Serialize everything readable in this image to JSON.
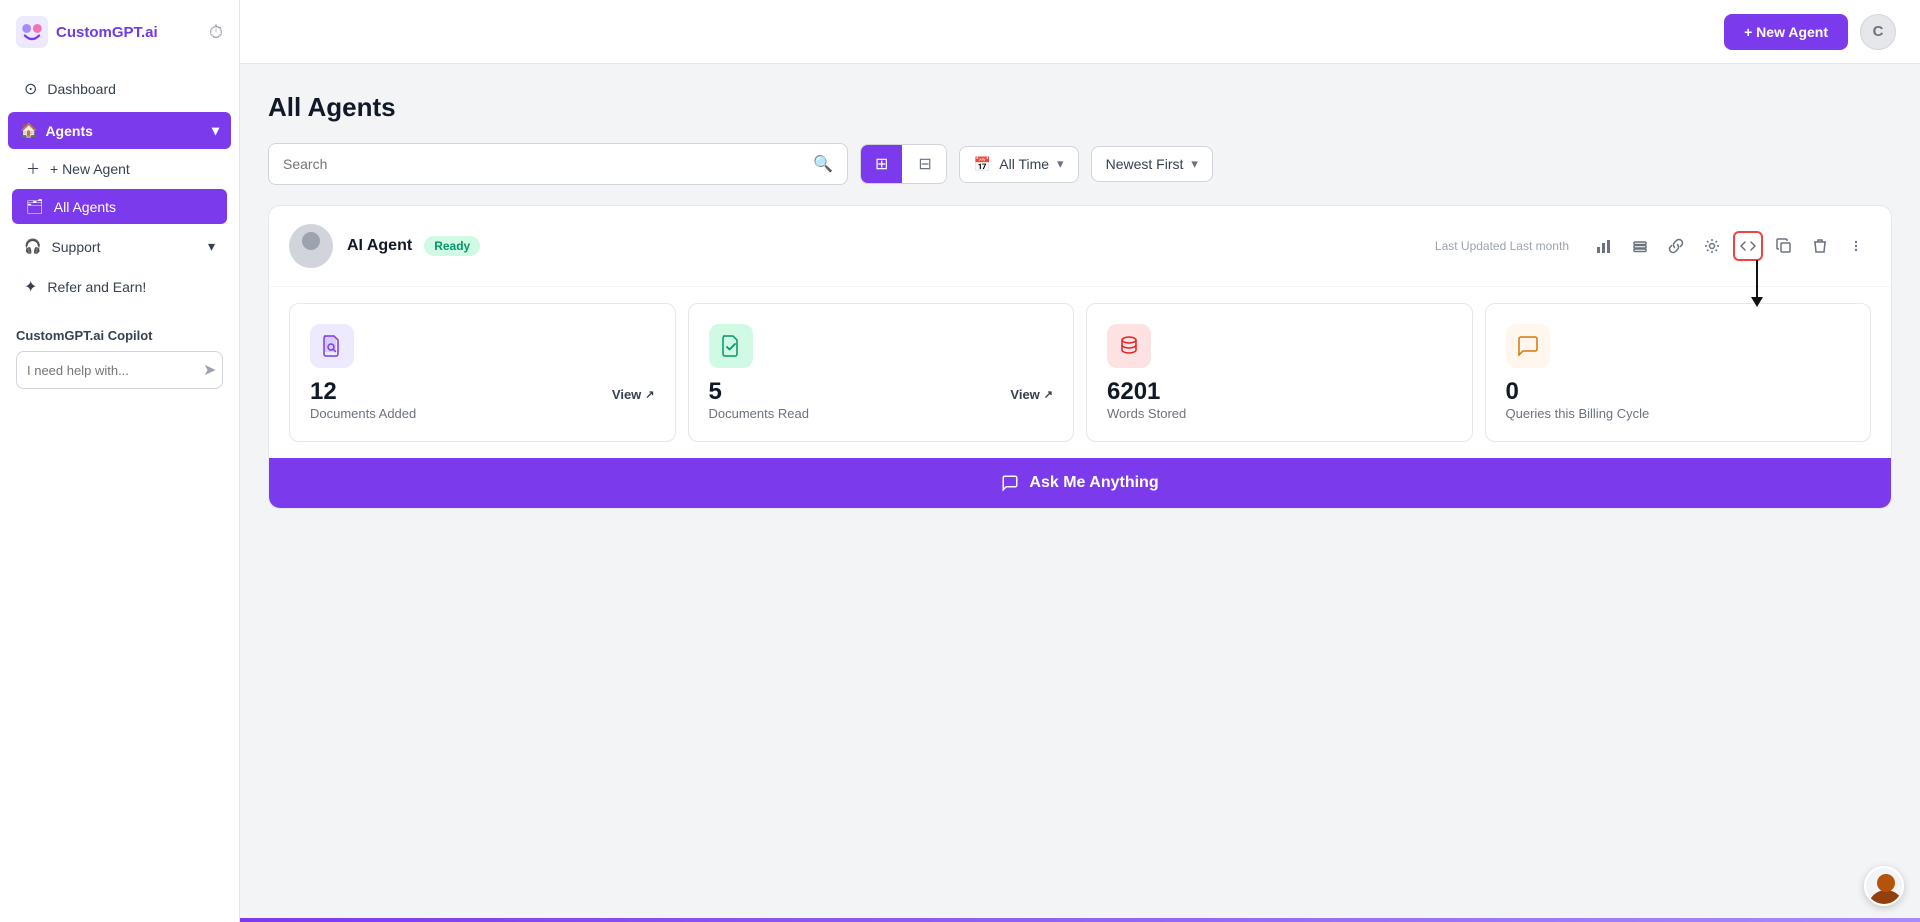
{
  "app": {
    "name": "CustomGPT.ai",
    "logo_emoji": "🤖"
  },
  "sidebar": {
    "dashboard_label": "Dashboard",
    "agents_label": "Agents",
    "new_agent_label": "+ New Agent",
    "all_agents_label": "All Agents",
    "support_label": "Support",
    "refer_label": "Refer and Earn!",
    "copilot_section_label": "CustomGPT.ai Copilot",
    "copilot_placeholder": "I need help with..."
  },
  "topbar": {
    "new_agent_label": "+ New Agent",
    "avatar_initial": "C"
  },
  "page": {
    "title": "All Agents",
    "search_placeholder": "Search"
  },
  "filter_bar": {
    "time_filter": "All Time",
    "sort_filter": "Newest First"
  },
  "agent": {
    "name": "AI Agent",
    "status": "Ready",
    "last_updated_label": "Last Updated",
    "last_updated_value": "Last month"
  },
  "stats": [
    {
      "value": "12",
      "label": "Documents Added",
      "has_view": true,
      "view_label": "View",
      "icon_type": "purple",
      "icon_char": "📄"
    },
    {
      "value": "5",
      "label": "Documents Read",
      "has_view": true,
      "view_label": "View",
      "icon_type": "teal",
      "icon_char": "📋"
    },
    {
      "value": "6201",
      "label": "Words Stored",
      "has_view": false,
      "icon_type": "red",
      "icon_char": "🗄"
    },
    {
      "value": "0",
      "label": "Queries this Billing Cycle",
      "has_view": false,
      "icon_type": "orange",
      "icon_char": "💬"
    }
  ],
  "ask_bar": {
    "label": "Ask Me Anything",
    "icon": "💬"
  },
  "action_buttons": [
    {
      "name": "stats-icon",
      "char": "📊",
      "highlighted": false
    },
    {
      "name": "data-icon",
      "char": "🗂",
      "highlighted": false
    },
    {
      "name": "link-icon",
      "char": "🔗",
      "highlighted": false
    },
    {
      "name": "settings-icon",
      "char": "⚙",
      "highlighted": false
    },
    {
      "name": "embed-icon",
      "char": "🔌",
      "highlighted": true
    },
    {
      "name": "copy-icon",
      "char": "📋",
      "highlighted": false
    },
    {
      "name": "delete-icon",
      "char": "🗑",
      "highlighted": false
    },
    {
      "name": "more-icon",
      "char": "⋯",
      "highlighted": false
    }
  ]
}
